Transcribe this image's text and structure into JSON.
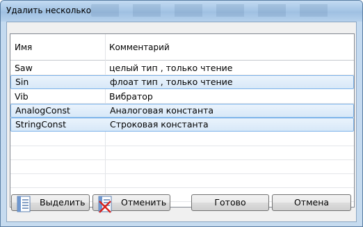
{
  "window": {
    "title": "Удалить несколько"
  },
  "grid": {
    "columns": [
      "Имя",
      "Комментарий"
    ],
    "rows": [
      {
        "name": "Saw",
        "comment": "целый тип , только чтение",
        "selected": false
      },
      {
        "name": "Sin",
        "comment": "флоат тип , только чтение",
        "selected": true
      },
      {
        "name": "Vib",
        "comment": "Вибратор",
        "selected": false
      },
      {
        "name": "AnalogConst",
        "comment": "Аналоговая константа",
        "selected": true
      },
      {
        "name": "StringConst",
        "comment": "Строковая константа",
        "selected": true
      }
    ]
  },
  "buttons": {
    "select_all": "Выделить",
    "deselect": "Отменить",
    "done": "Готово",
    "cancel": "Отмена"
  },
  "icons": {
    "select_all": "list-select-icon",
    "deselect": "list-deselect-icon"
  },
  "colors": {
    "selection_border": "#7eb4ea",
    "selection_fill": "#dbeaf9",
    "title_bar": "#a6c6e6"
  }
}
